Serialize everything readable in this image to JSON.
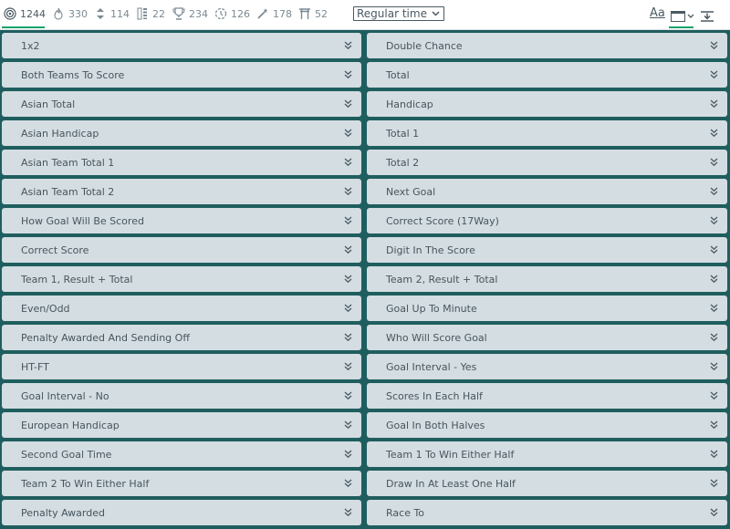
{
  "tabs": [
    {
      "icon": "target-icon",
      "count": "1244",
      "active": true
    },
    {
      "icon": "flame-icon",
      "count": "330"
    },
    {
      "icon": "up-down-arrows-icon",
      "count": "114"
    },
    {
      "icon": "bars-list-icon",
      "count": "22"
    },
    {
      "icon": "trophy-icon",
      "count": "234"
    },
    {
      "icon": "clock-dashed-icon",
      "count": "126"
    },
    {
      "icon": "magic-wand-icon",
      "count": "178"
    },
    {
      "icon": "gate-icon",
      "count": "52"
    }
  ],
  "period_select": {
    "value": "Regular time"
  },
  "toolbar": {
    "font_icon_label": "Aa",
    "layout_icon": "columns-layout-icon",
    "collapse_icon": "collapse-all-icon"
  },
  "markets_left": [
    "1x2",
    "Both Teams To Score",
    "Asian Total",
    "Asian Handicap",
    "Asian Team Total 1",
    "Asian Team Total 2",
    "How Goal Will Be Scored",
    "Correct Score",
    "Team 1, Result + Total",
    "Even/Odd",
    "Penalty Awarded And Sending Off",
    "HT-FT",
    "Goal Interval - No",
    "European Handicap",
    "Second Goal Time",
    "Team 2 To Win Either Half",
    "Penalty Awarded"
  ],
  "markets_right": [
    "Double Chance",
    "Total",
    "Handicap",
    "Total 1",
    "Total 2",
    "Next Goal",
    "Correct Score (17Way)",
    "Digit In The Score",
    "Team 2, Result + Total",
    "Goal Up To Minute",
    "Who Will Score Goal",
    "Goal Interval - Yes",
    "Scores In Each Half",
    "Goal In Both Halves",
    "Team 1 To Win Either Half",
    "Draw In At Least One Half",
    "Race To"
  ]
}
